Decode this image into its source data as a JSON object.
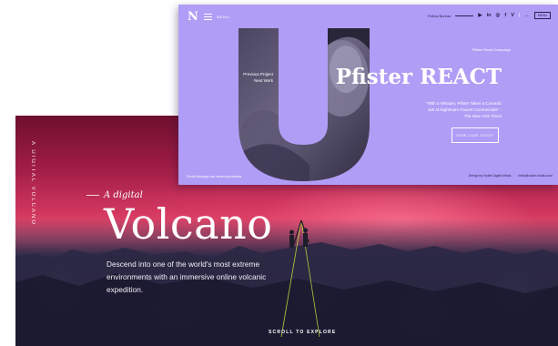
{
  "volcano": {
    "vertical_label": "A DIGITAL VOLCANO",
    "kicker": "A digital",
    "title": "Volcano",
    "description": "Descend into one of the world's most extreme environments with an immersive online volcanic expedition.",
    "scroll_cta": "SCROLL TO EXPLORE"
  },
  "pfister": {
    "logo": "N",
    "menu_label": "MENU",
    "topbar": {
      "left_label": "Follow Bureau",
      "social": [
        "▶",
        "in",
        "◎",
        "f",
        "V"
      ],
      "button": "MENU"
    },
    "project_caption": "Previous Project",
    "next_caption": "Next Work",
    "tag": "Pfister React Campaign",
    "title": "Pfister REACT",
    "quote": "\"With a Whisper, Pfister Takes a Comedic Jab at Nightmare Faucet Commercials\" - The New York Times",
    "cta": "VIEW CASE STUDY",
    "footer_left": "Scroll through our recent products",
    "footer_right": [
      "Design by Noble Digital Minds",
      "hello@noble-studio.com"
    ]
  }
}
